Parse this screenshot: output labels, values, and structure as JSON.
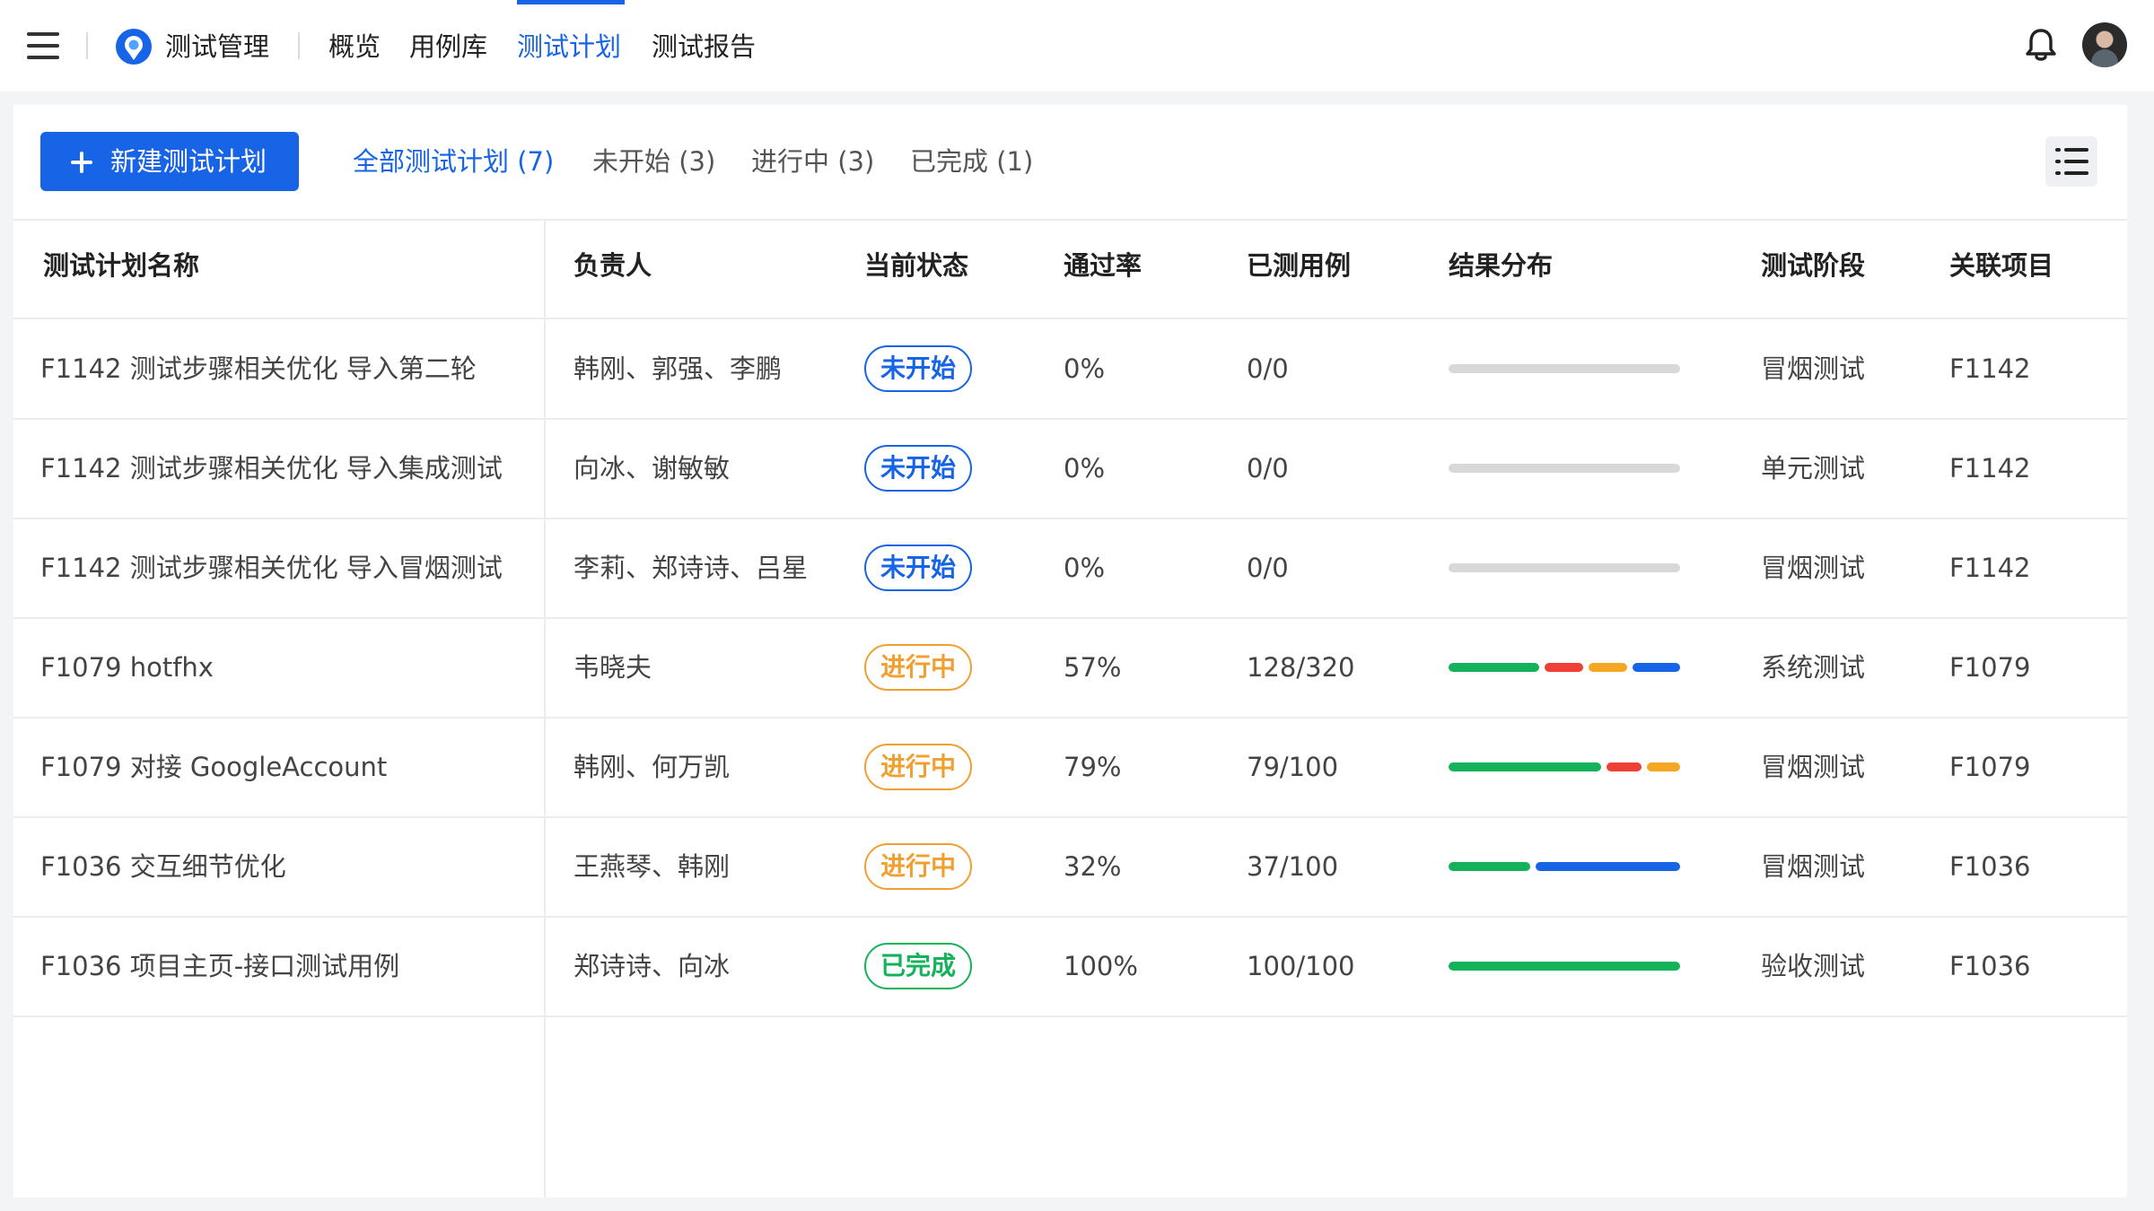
{
  "app": {
    "title": "测试管理"
  },
  "nav": {
    "tabs": [
      {
        "label": "概览",
        "active": false
      },
      {
        "label": "用例库",
        "active": false
      },
      {
        "label": "测试计划",
        "active": true
      },
      {
        "label": "测试报告",
        "active": false
      }
    ]
  },
  "toolbar": {
    "new_button_label": "新建测试计划",
    "filters": [
      {
        "label": "全部测试计划 (7)",
        "active": true
      },
      {
        "label": "未开始 (3)",
        "active": false
      },
      {
        "label": "进行中 (3)",
        "active": false
      },
      {
        "label": "已完成 (1)",
        "active": false
      }
    ]
  },
  "table": {
    "columns": [
      "测试计划名称",
      "负责人",
      "当前状态",
      "通过率",
      "已测用例",
      "结果分布",
      "测试阶段",
      "关联项目"
    ],
    "rows": [
      {
        "name": "F1142 测试步骤相关优化 导入第二轮",
        "owner": "韩刚、郭强、李鹏",
        "status": "未开始",
        "status_type": "not-started",
        "pass_rate": "0%",
        "tested": "0/0",
        "stage": "冒烟测试",
        "project": "F1142",
        "distribution": [
          {
            "fraction": 1.0,
            "color": "#d8d8d8"
          }
        ]
      },
      {
        "name": "F1142 测试步骤相关优化 导入集成测试",
        "owner": "向冰、谢敏敏",
        "status": "未开始",
        "status_type": "not-started",
        "pass_rate": "0%",
        "tested": "0/0",
        "stage": "单元测试",
        "project": "F1142",
        "distribution": [
          {
            "fraction": 1.0,
            "color": "#d8d8d8"
          }
        ]
      },
      {
        "name": "F1142 测试步骤相关优化 导入冒烟测试",
        "owner": "李莉、郑诗诗、吕星",
        "status": "未开始",
        "status_type": "not-started",
        "pass_rate": "0%",
        "tested": "0/0",
        "stage": "冒烟测试",
        "project": "F1142",
        "distribution": [
          {
            "fraction": 1.0,
            "color": "#d8d8d8"
          }
        ]
      },
      {
        "name": "F1079 hotfhx",
        "owner": "韦晓夫",
        "status": "进行中",
        "status_type": "in-progress",
        "pass_rate": "57%",
        "tested": "128/320",
        "stage": "系统测试",
        "project": "F1079",
        "distribution": [
          {
            "fraction": 0.42,
            "color": "#14b25a"
          },
          {
            "fraction": 0.18,
            "color": "#ee4036"
          },
          {
            "fraction": 0.18,
            "color": "#f5a623"
          },
          {
            "fraction": 0.22,
            "color": "#1764e6"
          }
        ]
      },
      {
        "name": "F1079 对接 GoogleAccount",
        "owner": "韩刚、何万凯",
        "status": "进行中",
        "status_type": "in-progress",
        "pass_rate": "79%",
        "tested": "79/100",
        "stage": "冒烟测试",
        "project": "F1079",
        "distribution": [
          {
            "fraction": 0.69,
            "color": "#14b25a"
          },
          {
            "fraction": 0.16,
            "color": "#ee4036"
          },
          {
            "fraction": 0.15,
            "color": "#f5a623"
          }
        ]
      },
      {
        "name": "F1036 交互细节优化",
        "owner": "王燕琴、韩刚",
        "status": "进行中",
        "status_type": "in-progress",
        "pass_rate": "32%",
        "tested": "37/100",
        "stage": "冒烟测试",
        "project": "F1036",
        "distribution": [
          {
            "fraction": 0.36,
            "color": "#14b25a"
          },
          {
            "fraction": 0.64,
            "color": "#1764e6"
          }
        ]
      },
      {
        "name": "F1036 项目主页-接口测试用例",
        "owner": "郑诗诗、向冰",
        "status": "已完成",
        "status_type": "done",
        "pass_rate": "100%",
        "tested": "100/100",
        "stage": "验收测试",
        "project": "F1036",
        "distribution": [
          {
            "fraction": 1.0,
            "color": "#14b25a"
          }
        ]
      }
    ]
  },
  "icons": {
    "menu": "hamburger-menu-icon",
    "logo": "app-logo-icon",
    "bell": "bell-icon",
    "list_view": "list-view-icon",
    "add": "plus-icon"
  },
  "colors": {
    "accent": "#1764e6",
    "success": "#14b25a",
    "warning": "#f0a030",
    "danger": "#ee4036"
  }
}
